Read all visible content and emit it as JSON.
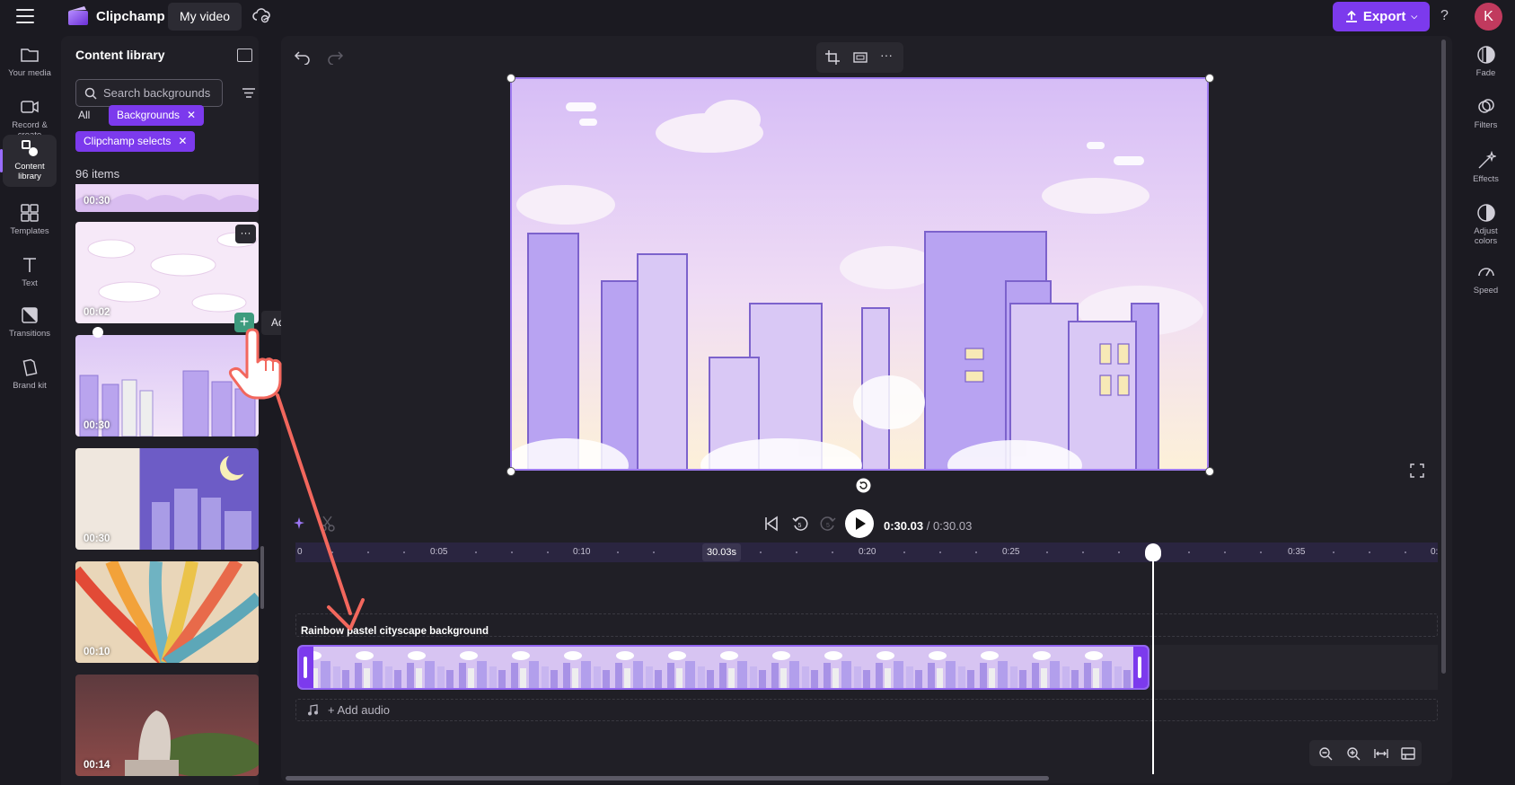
{
  "topbar": {
    "brand": "Clipchamp",
    "project_name": "My video",
    "export_label": "Export",
    "help_label": "?",
    "avatar_initial": "K"
  },
  "left_nav": [
    {
      "label": "Your media",
      "icon": "folder-icon"
    },
    {
      "label": "Record & create",
      "icon": "camera-icon"
    },
    {
      "label": "Content library",
      "icon": "shapes-icon",
      "active": true
    },
    {
      "label": "Templates",
      "icon": "templates-icon"
    },
    {
      "label": "Text",
      "icon": "text-icon"
    },
    {
      "label": "Transitions",
      "icon": "transitions-icon"
    },
    {
      "label": "Brand kit",
      "icon": "brand-kit-icon"
    }
  ],
  "library": {
    "title": "Content library",
    "search_placeholder": "Search backgrounds",
    "chips": [
      {
        "label": "All",
        "selected": false
      },
      {
        "label": "Backgrounds",
        "selected": true
      },
      {
        "label": "Clipchamp selects",
        "selected": true
      }
    ],
    "count": "96 items",
    "items": [
      {
        "duration": "00:30"
      },
      {
        "duration": "00:02"
      },
      {
        "duration": "00:30"
      },
      {
        "duration": "00:30"
      },
      {
        "duration": "00:10"
      },
      {
        "duration": "00:14"
      }
    ],
    "more_label": "···",
    "add_tooltip": "Add to timeline",
    "add_label": "+"
  },
  "player": {
    "current_time": "0:30.03",
    "total_time": "/ 0:30.03"
  },
  "ruler": {
    "ticks": [
      "0",
      "0:05",
      "0:10",
      "0:20",
      "0:25",
      "0:35",
      "0:"
    ],
    "playhead_badge": "30.03s"
  },
  "timeline": {
    "clip_title": "Rainbow pastel cityscape background",
    "add_audio": "+ Add audio"
  },
  "right_nav": [
    {
      "label": "Fade",
      "icon": "fade-icon"
    },
    {
      "label": "Filters",
      "icon": "filters-icon"
    },
    {
      "label": "Effects",
      "icon": "effects-icon"
    },
    {
      "label": "Adjust colors",
      "icon": "adjust-colors-icon"
    },
    {
      "label": "Speed",
      "icon": "speed-icon"
    }
  ],
  "colors": {
    "accent": "#7c3aed",
    "add_button": "#3e9b7e",
    "drag_arrow": "#f2675d"
  }
}
